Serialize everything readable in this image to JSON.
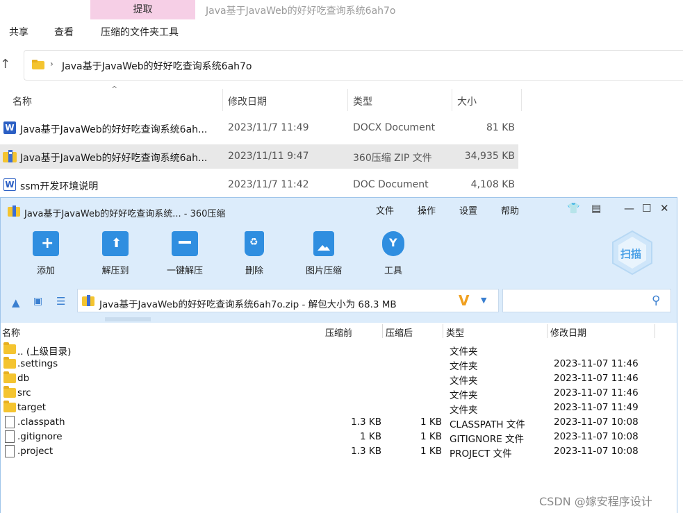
{
  "explorer": {
    "context_tab": "提取",
    "window_title": "Java基于JavaWeb的好好吃查询系统6ah7o",
    "ribbon_tabs": [
      "共享",
      "查看",
      "压缩的文件夹工具"
    ],
    "address": "Java基于JavaWeb的好好吃查询系统6ah7o",
    "columns": [
      "名称",
      "修改日期",
      "类型",
      "大小"
    ],
    "files": [
      {
        "name": "Java基于JavaWeb的好好吃查询系统6ah...",
        "date": "2023/11/7 11:49",
        "type": "DOCX Document",
        "size": "81 KB",
        "icon": "word-icon"
      },
      {
        "name": "Java基于JavaWeb的好好吃查询系统6ah...",
        "date": "2023/11/11 9:47",
        "type": "360压缩 ZIP 文件",
        "size": "34,935 KB",
        "icon": "zip-archive-icon"
      },
      {
        "name": "ssm开发环境说明",
        "date": "2023/11/7 11:42",
        "type": "DOC Document",
        "size": "4,108 KB",
        "icon": "word-icon"
      }
    ]
  },
  "zip_window": {
    "title": "Java基于JavaWeb的好好吃查询系统... - 360压缩",
    "menu": [
      "文件",
      "操作",
      "设置",
      "帮助"
    ],
    "toolbar": [
      "添加",
      "解压到",
      "一键解压",
      "删除",
      "图片压缩",
      "工具"
    ],
    "scan_label": "扫描",
    "path": "Java基于JavaWeb的好好吃查询系统6ah7o.zip - 解包大小为 68.3 MB",
    "columns": [
      "名称",
      "压缩前",
      "压缩后",
      "类型",
      "修改日期"
    ],
    "entries": [
      {
        "name": ".. (上级目录)",
        "before": "",
        "after": "",
        "type": "文件夹",
        "date": "",
        "kind": "folder"
      },
      {
        "name": ".settings",
        "before": "",
        "after": "",
        "type": "文件夹",
        "date": "2023-11-07 11:46",
        "kind": "folder"
      },
      {
        "name": "db",
        "before": "",
        "after": "",
        "type": "文件夹",
        "date": "2023-11-07 11:46",
        "kind": "folder"
      },
      {
        "name": "src",
        "before": "",
        "after": "",
        "type": "文件夹",
        "date": "2023-11-07 11:46",
        "kind": "folder"
      },
      {
        "name": "target",
        "before": "",
        "after": "",
        "type": "文件夹",
        "date": "2023-11-07 11:49",
        "kind": "folder"
      },
      {
        "name": ".classpath",
        "before": "1.3 KB",
        "after": "1 KB",
        "type": "CLASSPATH 文件",
        "date": "2023-11-07 10:08",
        "kind": "file"
      },
      {
        "name": ".gitignore",
        "before": "1 KB",
        "after": "1 KB",
        "type": "GITIGNORE 文件",
        "date": "2023-11-07 10:08",
        "kind": "file"
      },
      {
        "name": ".project",
        "before": "1.3 KB",
        "after": "1 KB",
        "type": "PROJECT 文件",
        "date": "2023-11-07 10:08",
        "kind": "file"
      }
    ]
  },
  "watermark": "CSDN @嫁安程序设计"
}
